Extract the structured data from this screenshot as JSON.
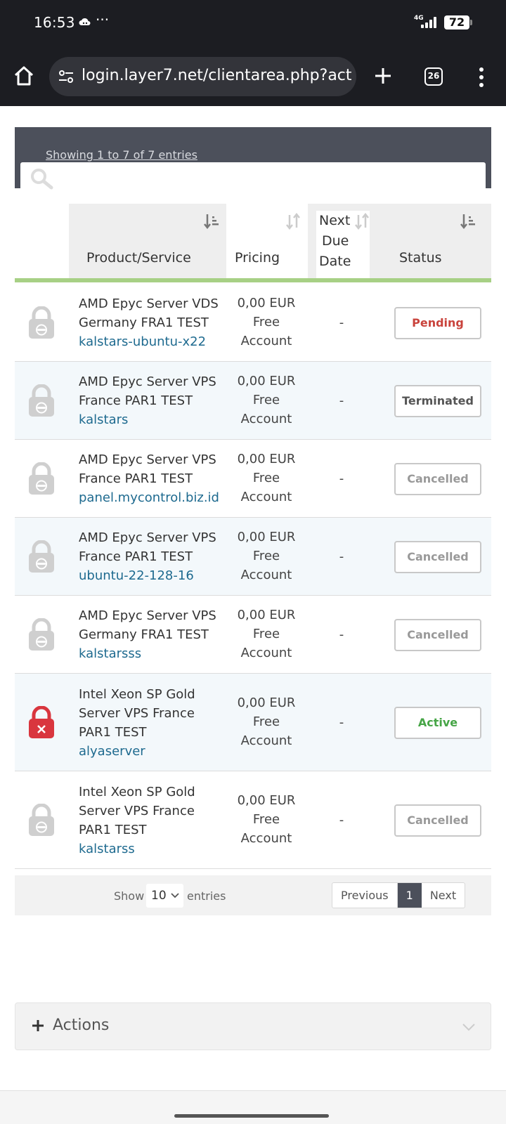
{
  "status_bar": {
    "time": "16:53",
    "notification_icon": "cloud-icon",
    "more": "···",
    "network": "4G",
    "battery": "72"
  },
  "browser": {
    "url": "login.layer7.net/clientarea.php?actio",
    "tab_count": "26"
  },
  "table": {
    "showing_text": "Showing 1 to 7 of 7 entries",
    "search_placeholder": "",
    "headers": {
      "product": "Product/Service",
      "pricing": "Pricing",
      "next_due_1": "Next",
      "next_due_2": "Due",
      "next_due_3": "Date",
      "status": "Status"
    },
    "rows": [
      {
        "name_1": "AMD Epyc Server VDS",
        "name_2": "Germany FRA1 TEST",
        "name_3": "",
        "domain": "kalstars-ubuntu-x22",
        "price_1": "0,00 EUR",
        "price_2": "Free",
        "price_3": "Account",
        "due": "-",
        "status": "Pending",
        "status_color": "#c9433c",
        "lock": "lock-grey-icon"
      },
      {
        "name_1": "AMD Epyc Server VPS",
        "name_2": "France PAR1 TEST",
        "name_3": "",
        "domain": "kalstars",
        "price_1": "0,00 EUR",
        "price_2": "Free",
        "price_3": "Account",
        "due": "-",
        "status": "Terminated",
        "status_color": "#555555",
        "lock": "lock-grey-icon"
      },
      {
        "name_1": "AMD Epyc Server VPS",
        "name_2": "France PAR1 TEST",
        "name_3": "",
        "domain": "panel.mycontrol.biz.id",
        "price_1": "0,00 EUR",
        "price_2": "Free",
        "price_3": "Account",
        "due": "-",
        "status": "Cancelled",
        "status_color": "#999999",
        "lock": "lock-grey-icon"
      },
      {
        "name_1": "AMD Epyc Server VPS",
        "name_2": "France PAR1 TEST",
        "name_3": "",
        "domain": "ubuntu-22-128-16",
        "price_1": "0,00 EUR",
        "price_2": "Free",
        "price_3": "Account",
        "due": "-",
        "status": "Cancelled",
        "status_color": "#999999",
        "lock": "lock-grey-icon"
      },
      {
        "name_1": "AMD Epyc Server VPS",
        "name_2": "Germany FRA1 TEST",
        "name_3": "",
        "domain": "kalstarsss",
        "price_1": "0,00 EUR",
        "price_2": "Free",
        "price_3": "Account",
        "due": "-",
        "status": "Cancelled",
        "status_color": "#999999",
        "lock": "lock-grey-icon"
      },
      {
        "name_1": "Intel Xeon SP Gold",
        "name_2": "Server VPS France",
        "name_3": "PAR1 TEST",
        "domain": "alyaserver",
        "price_1": "0,00 EUR",
        "price_2": "Free",
        "price_3": "Account",
        "due": "-",
        "status": "Active",
        "status_color": "#46a546",
        "lock": "lock-red-icon"
      },
      {
        "name_1": "Intel Xeon SP Gold",
        "name_2": "Server VPS France",
        "name_3": "PAR1 TEST",
        "domain": "kalstarss",
        "price_1": "0,00 EUR",
        "price_2": "Free",
        "price_3": "Account",
        "due": "-",
        "status": "Cancelled",
        "status_color": "#999999",
        "lock": "lock-grey-icon"
      }
    ]
  },
  "footer": {
    "show_label": "Show",
    "page_size": "10",
    "entries_label": "entries",
    "previous": "Previous",
    "current_page": "1",
    "next": "Next"
  },
  "actions": {
    "label": "Actions"
  },
  "colors": {
    "dark_header": "#4c505b",
    "accent_green": "#a7d085",
    "link_blue": "#1e6a8f"
  }
}
